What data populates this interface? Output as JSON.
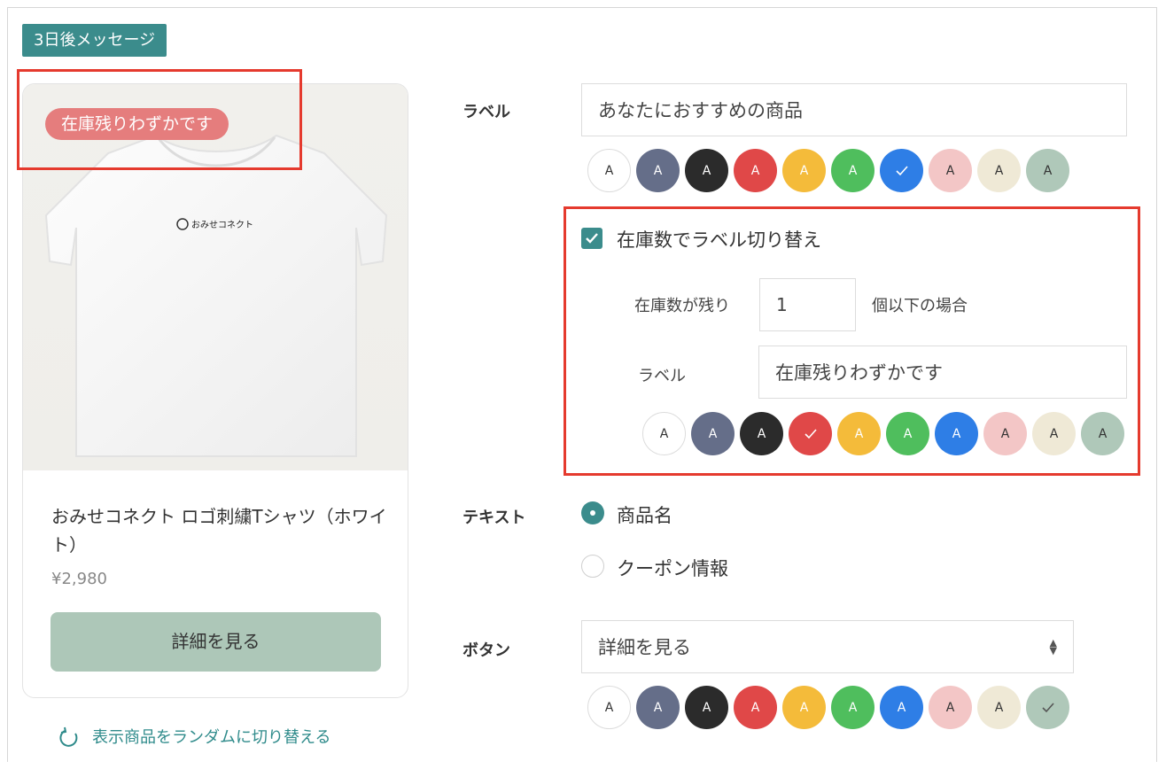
{
  "header": {
    "tag": "3日後メッセージ"
  },
  "card": {
    "stock_badge": "在庫残りわずかです",
    "shirt_logo": "おみせコネクト",
    "product_name": "おみせコネクト ロゴ刺繍Tシャツ（ホワイト）",
    "price": "¥2,980",
    "button_label": "詳細を見る"
  },
  "random_switch": "表示商品をランダムに切り替える",
  "label_section": {
    "title": "ラベル",
    "value": "あなたにおすすめの商品",
    "swatch_text": "A",
    "selected_index": 6
  },
  "stock_switch": {
    "checkbox_label": "在庫数でラベル切り替え",
    "checked": true,
    "threshold_prefix": "在庫数が残り",
    "threshold_value": "1",
    "threshold_suffix": "個以下の場合",
    "label_title": "ラベル",
    "label_value": "在庫残りわずかです",
    "selected_index": 3
  },
  "text_section": {
    "title": "テキスト",
    "options": [
      "商品名",
      "クーポン情報"
    ],
    "selected": "商品名"
  },
  "button_section": {
    "title": "ボタン",
    "value": "詳細を見る",
    "selected_index": 9
  },
  "palette": [
    "#ffffff",
    "#656e89",
    "#2b2b2b",
    "#e04848",
    "#f4bb3a",
    "#4fbe5d",
    "#2e7ee6",
    "#f3c6c6",
    "#efe9d6",
    "#afc8b9"
  ],
  "palette_names": [
    "white",
    "slate",
    "black",
    "red",
    "yellow",
    "green",
    "blue",
    "pink",
    "cream",
    "sage"
  ],
  "colors": {
    "accent": "#3b8c8c",
    "highlight": "#e53a2e",
    "badge": "#e57d7d"
  }
}
